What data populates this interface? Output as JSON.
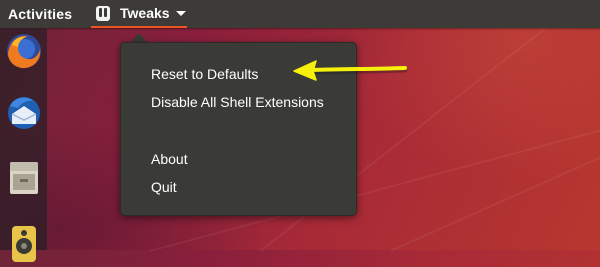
{
  "top_bar": {
    "activities_label": "Activities",
    "app_menu": {
      "label": "Tweaks",
      "icon": "tweaks-icon",
      "dropdown_icon": "chevron-down-icon"
    }
  },
  "dock": {
    "items": [
      {
        "name": "Firefox",
        "icon": "firefox-icon"
      },
      {
        "name": "Thunderbird",
        "icon": "thunderbird-icon"
      },
      {
        "name": "Files",
        "icon": "file-cabinet-icon"
      },
      {
        "name": "Rhythmbox",
        "icon": "speaker-icon"
      }
    ]
  },
  "app_menu_popover": {
    "items": [
      {
        "label": "Reset to Defaults"
      },
      {
        "label": "Disable All Shell Extensions"
      },
      {
        "label": "About"
      },
      {
        "label": "Quit"
      }
    ]
  },
  "annotation": {
    "icon": "arrow-left-icon",
    "color": "#f5f10a"
  },
  "colors": {
    "top_bar": "#3c3b37",
    "accent_underline": "#e95420",
    "menu_background": "#3a3a37"
  }
}
